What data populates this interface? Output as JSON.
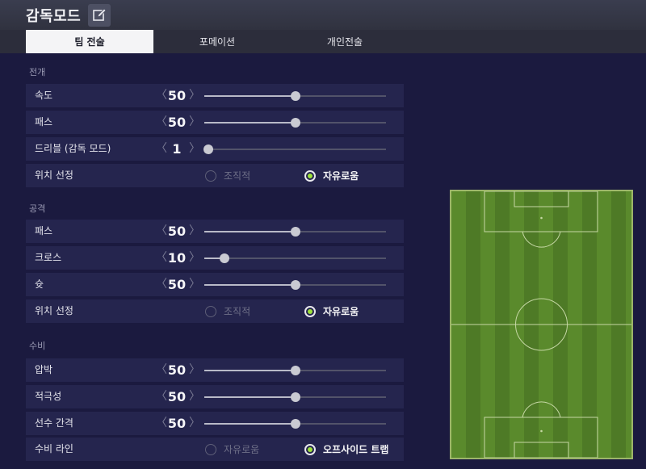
{
  "header": {
    "title": "감독모드",
    "edit_icon": "edit-icon"
  },
  "tabs": [
    {
      "label": "팀 전술",
      "active": true
    },
    {
      "label": "포메이션",
      "active": false
    },
    {
      "label": "개인전술",
      "active": false
    }
  ],
  "sections": {
    "buildup": {
      "title": "전개",
      "speed": {
        "label": "속도",
        "value": "50"
      },
      "passing": {
        "label": "패스",
        "value": "50"
      },
      "dribble": {
        "label": "드리블 (감독 모드)",
        "value": "1"
      },
      "positioning": {
        "label": "위치 선정",
        "option_a": "조직적",
        "option_b": "자유로움",
        "selected": "자유로움"
      }
    },
    "attack": {
      "title": "공격",
      "passing": {
        "label": "패스",
        "value": "50"
      },
      "crossing": {
        "label": "크로스",
        "value": "10"
      },
      "shooting": {
        "label": "슛",
        "value": "50"
      },
      "positioning": {
        "label": "위치 선정",
        "option_a": "조직적",
        "option_b": "자유로움",
        "selected": "자유로움"
      }
    },
    "defence": {
      "title": "수비",
      "pressure": {
        "label": "압박",
        "value": "50"
      },
      "aggression": {
        "label": "적극성",
        "value": "50"
      },
      "width": {
        "label": "선수 간격",
        "value": "50"
      },
      "line": {
        "label": "수비 라인",
        "option_a": "자유로움",
        "option_b": "오프사이드 트랩",
        "selected": "오프사이드 트랩"
      }
    }
  },
  "colors": {
    "background": "#1b1a3f",
    "row": "#25254e",
    "accent": "#9ee33a",
    "pitch_dark": "#4e7a26",
    "pitch_light": "#5a8a2c"
  }
}
